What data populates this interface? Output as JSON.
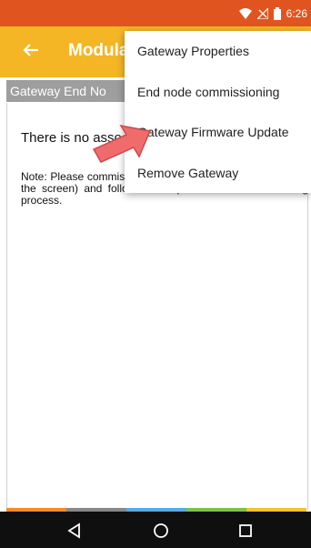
{
  "status": {
    "time": "6:26",
    "icons": [
      "wifi-icon",
      "signal-icon",
      "battery-icon"
    ]
  },
  "appbar": {
    "title": "Modula",
    "back_icon": "arrow-back-icon",
    "color": "#f5b625"
  },
  "section": {
    "title": "Gateway End No"
  },
  "main": {
    "message": "There is no associated",
    "note": "Note: Please commissioning\" from option menu(top right of the screen) and follow the steps to start commissioning process."
  },
  "menu": {
    "items": [
      {
        "label": "Gateway Properties"
      },
      {
        "label": "End node commissioning"
      },
      {
        "label": "Gateway Firmware Update"
      },
      {
        "label": "Remove Gateway"
      }
    ]
  },
  "colors": {
    "status_bar": "#e0551f",
    "app_bar": "#f5b625",
    "highlight_arrow": "#f06b6b"
  },
  "navbar": {
    "buttons": [
      "back-triangle-icon",
      "home-circle-icon",
      "recents-square-icon"
    ]
  }
}
